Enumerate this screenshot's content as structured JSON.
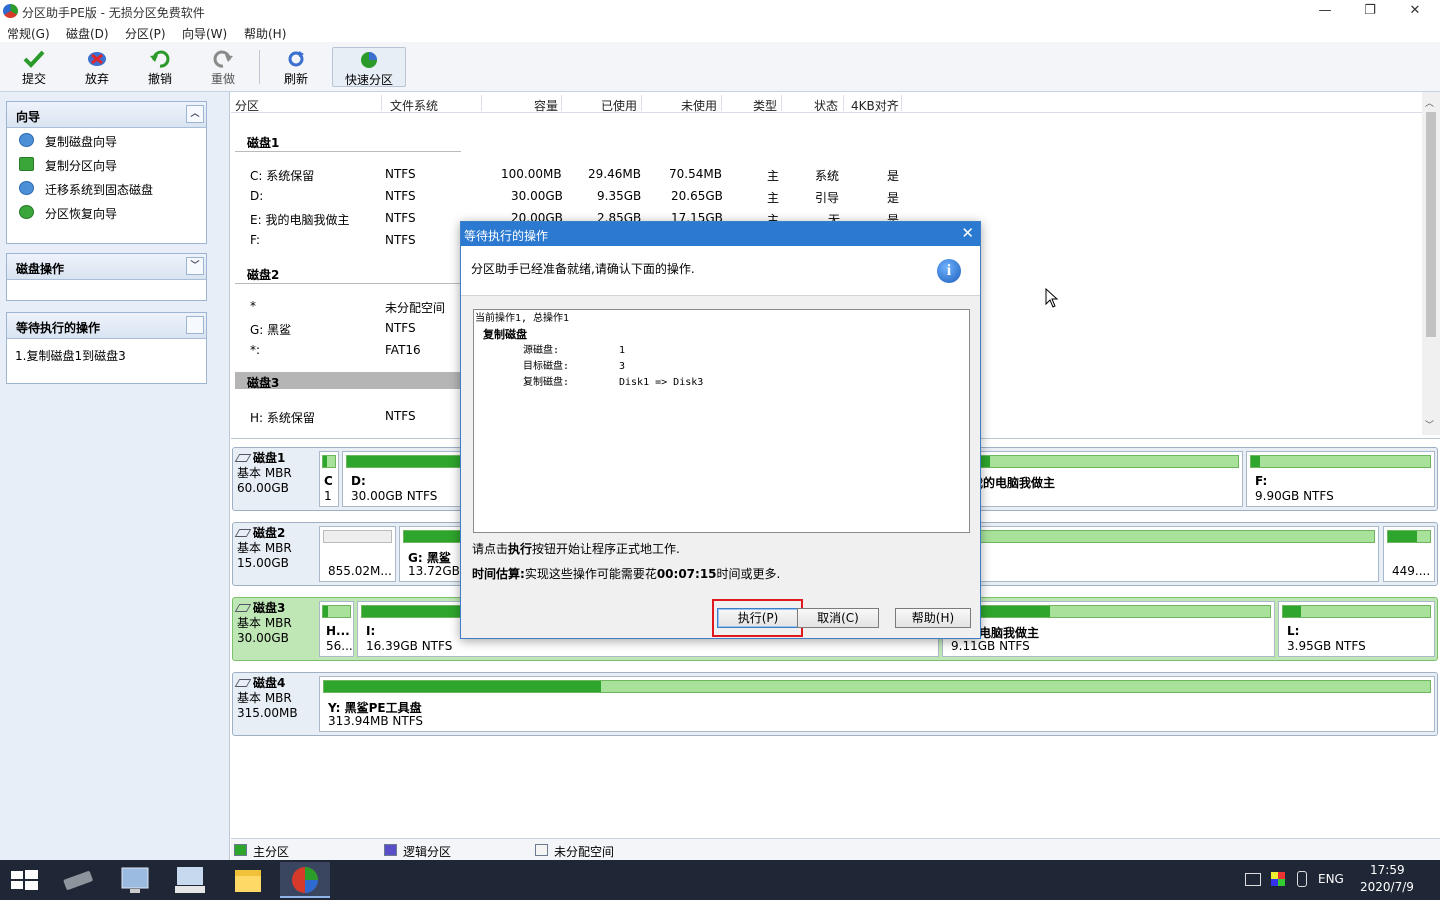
{
  "window": {
    "title": "分区助手PE版 - 无损分区免费软件",
    "minimize": "—",
    "restore": "❐",
    "close": "✕"
  },
  "menu": [
    {
      "label": "常规(G)"
    },
    {
      "label": "磁盘(D)"
    },
    {
      "label": "分区(P)"
    },
    {
      "label": "向导(W)"
    },
    {
      "label": "帮助(H)"
    }
  ],
  "toolbar": {
    "commit": "提交",
    "discard": "放弃",
    "undo": "撤销",
    "redo": "重做",
    "refresh": "刷新",
    "quick": "快速分区"
  },
  "left": {
    "wizard_title": "向导",
    "wizard_items": [
      {
        "label": "复制磁盘向导"
      },
      {
        "label": "复制分区向导"
      },
      {
        "label": "迁移系统到固态磁盘"
      },
      {
        "label": "分区恢复向导"
      }
    ],
    "diskops_title": "磁盘操作",
    "pending_title": "等待执行的操作",
    "pending_items": [
      {
        "label": "1.复制磁盘1到磁盘3"
      }
    ]
  },
  "table": {
    "headers": {
      "partition": "分区",
      "fs": "文件系统",
      "capacity": "容量",
      "used": "已使用",
      "unused": "未使用",
      "type": "类型",
      "status": "状态",
      "align": "4KB对齐"
    },
    "disk1": "磁盘1",
    "rows1": [
      {
        "p": "C: 系统保留",
        "fs": "NTFS",
        "cap": "100.00MB",
        "used": "29.46MB",
        "unused": "70.54MB",
        "type": "主",
        "status": "系统",
        "align": "是"
      },
      {
        "p": "D:",
        "fs": "NTFS",
        "cap": "30.00GB",
        "used": "9.35GB",
        "unused": "20.65GB",
        "type": "主",
        "status": "引导",
        "align": "是"
      },
      {
        "p": "E: 我的电脑我做主",
        "fs": "NTFS",
        "cap": "20.00GB",
        "used": "2.85GB",
        "unused": "17.15GB",
        "type": "主",
        "status": "无",
        "align": "是"
      },
      {
        "p": "F:",
        "fs": "NTFS"
      }
    ],
    "disk2": "磁盘2",
    "rows2": [
      {
        "p": "*",
        "fs": "未分配空间"
      },
      {
        "p": "G: 黑鲨",
        "fs": "NTFS"
      },
      {
        "p": "*:",
        "fs": "FAT16"
      }
    ],
    "disk3": "磁盘3",
    "rows3": [
      {
        "p": "H: 系统保留",
        "fs": "NTFS"
      }
    ]
  },
  "disks": [
    {
      "name": "磁盘1",
      "type": "基本 MBR",
      "size": "60.00GB",
      "parts": [
        {
          "n": "C",
          "s": "1"
        },
        {
          "n": "D:",
          "s": "30.00GB NTFS"
        },
        {
          "n": "我的电脑我做主",
          "s": ""
        },
        {
          "n": "F:",
          "s": "9.90GB NTFS"
        }
      ]
    },
    {
      "name": "磁盘2",
      "type": "基本 MBR",
      "size": "15.00GB",
      "parts": [
        {
          "n": "",
          "s": "855.02M..."
        },
        {
          "n": "G: 黑鲨",
          "s": "13.72GB"
        },
        {
          "n": "",
          "s": "449...."
        }
      ]
    },
    {
      "name": "磁盘3",
      "type": "基本 MBR",
      "size": "30.00GB",
      "parts": [
        {
          "n": "H...",
          "s": "56..."
        },
        {
          "n": "I:",
          "s": "16.39GB NTFS"
        },
        {
          "n": "的电脑我做主",
          "s": "9.11GB NTFS"
        },
        {
          "n": "L:",
          "s": "3.95GB NTFS"
        }
      ]
    },
    {
      "name": "磁盘4",
      "type": "基本 MBR",
      "size": "315.00MB",
      "parts": [
        {
          "n": "Y: 黑鲨PE工具盘",
          "s": "313.94MB NTFS"
        }
      ]
    }
  ],
  "legend": {
    "primary": "主分区",
    "logical": "逻辑分区",
    "unalloc": "未分配空间"
  },
  "dialog": {
    "title": "等待执行的操作",
    "intro": "分区助手已经准备就绪,请确认下面的操作.",
    "memo_l1": "当前操作1, 总操作1",
    "memo_l2": "复制磁盘",
    "src_label": "源磁盘:",
    "src_val": "1",
    "dst_label": "目标磁盘:",
    "dst_val": "3",
    "copy_label": "复制磁盘:",
    "copy_val": "Disk1 => Disk3",
    "hint_pre": "请点击",
    "hint_bold": "执行",
    "hint_post": "按钮开始让程序正式地工作.",
    "est_label": "时间估算:",
    "est_pre": "实现这些操作可能需要花",
    "est_time": "00:07:15",
    "est_post": "时间或更多.",
    "exec": "执行(P)",
    "cancel": "取消(C)",
    "help": "帮助(H)"
  },
  "taskbar": {
    "lang": "ENG",
    "time": "17:59",
    "date": "2020/7/9"
  }
}
